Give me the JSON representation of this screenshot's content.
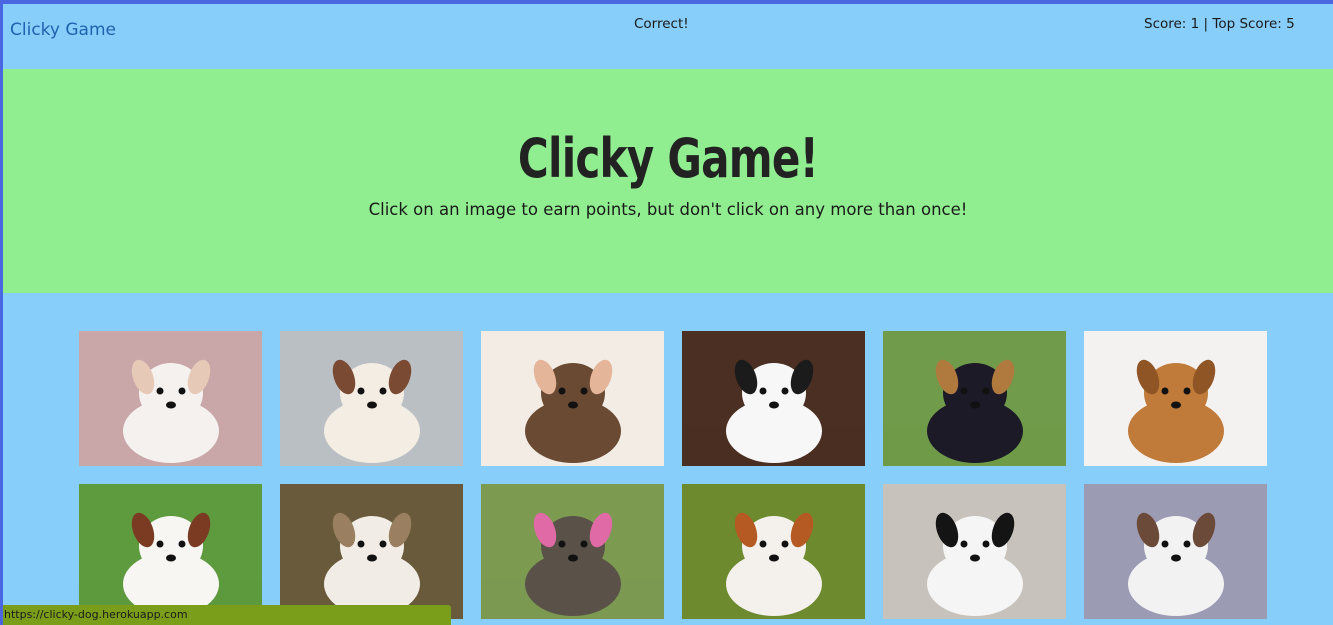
{
  "navbar": {
    "brand": "Clicky Game",
    "message": "Correct!",
    "score": "Score: 1 | Top Score: 5"
  },
  "jumbotron": {
    "title": "Clicky Game!",
    "instructions": "Click on an image to earn points, but don't click on any more than once!"
  },
  "cards": [
    {
      "name": "white-fluffy-puppy",
      "bg": "#c9a6a8",
      "fur": "#f4f1ee",
      "accent": "#e7c9b8"
    },
    {
      "name": "shih-tzu-puppy",
      "bg": "#b9bfc3",
      "fur": "#f3ede4",
      "accent": "#7a4a33"
    },
    {
      "name": "newborn-puppy-in-hand",
      "bg": "#f2ece4",
      "fur": "#6b4a33",
      "accent": "#e5b59a"
    },
    {
      "name": "two-bichon-frise",
      "bg": "#4a2f22",
      "fur": "#f7f7f7",
      "accent": "#1b1b1b"
    },
    {
      "name": "chihuahua-on-grass",
      "bg": "#6f9b4a",
      "fur": "#1c1a26",
      "accent": "#b07a3f"
    },
    {
      "name": "sleeping-golden-puppy",
      "bg": "#f4f2f0",
      "fur": "#c07a3a",
      "accent": "#8f5524"
    },
    {
      "name": "cavalier-puppy-on-grass",
      "bg": "#5e9a3e",
      "fur": "#f8f6f2",
      "accent": "#7a3b22"
    },
    {
      "name": "white-pomeranian-puppy",
      "bg": "#6a5a3c",
      "fur": "#f1ede6",
      "accent": "#9a8060"
    },
    {
      "name": "yorkshire-terrier",
      "bg": "#7c9a50",
      "fur": "#5a5248",
      "accent": "#e06aa6"
    },
    {
      "name": "cavalier-king-charles",
      "bg": "#6e8a2e",
      "fur": "#f4f0ec",
      "accent": "#b55a23"
    },
    {
      "name": "black-and-white-terrier",
      "bg": "#c8c2bc",
      "fur": "#f5f5f5",
      "accent": "#141414"
    },
    {
      "name": "jack-russell-lying",
      "bg": "#9c9bb4",
      "fur": "#f2f2f2",
      "accent": "#6b4a3a"
    }
  ],
  "status_bar": {
    "url": "https://clicky-dog.herokuapp.com"
  }
}
